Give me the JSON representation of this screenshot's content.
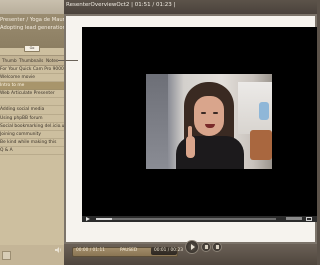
{
  "window": {
    "title": "ResenterOverviewOct2 | 01:51 / 01:23 |"
  },
  "sidebar": {
    "header_line1": "Presenter / Yoga de Maurel",
    "header_line2": "Adopting lead generation",
    "header_button": "Go",
    "tabs": [
      "Thumb",
      "Thumbnails",
      "Notes"
    ],
    "items": [
      {
        "label": "For Your Quick Cam Pro 9000",
        "selected": false
      },
      {
        "label": "Welcome movie",
        "selected": false
      },
      {
        "label": "Intro to me",
        "selected": true
      },
      {
        "label": "Web Articulate Presenter",
        "selected": false
      },
      {
        "label": "",
        "selected": false
      },
      {
        "label": "Adding social media",
        "selected": false
      },
      {
        "label": "Using phpBB forum",
        "selected": false
      },
      {
        "label": "Social bookmarking del.icio.us",
        "selected": false
      },
      {
        "label": "Joining community",
        "selected": false
      },
      {
        "label": "Be kind while making this",
        "selected": false
      },
      {
        "label": "Q & A",
        "selected": false
      }
    ]
  },
  "player": {
    "progress_fraction": 0.09
  },
  "bottom_bar": {
    "time": "00:00 / 01:11",
    "status": "PAUSED",
    "duration": "00:01 / 00:23"
  },
  "colors": {
    "sidebar_bg": "#cdbf9f",
    "selected_item": "#a8956b",
    "chrome": "#5b5249",
    "video_bg": "#000000"
  }
}
